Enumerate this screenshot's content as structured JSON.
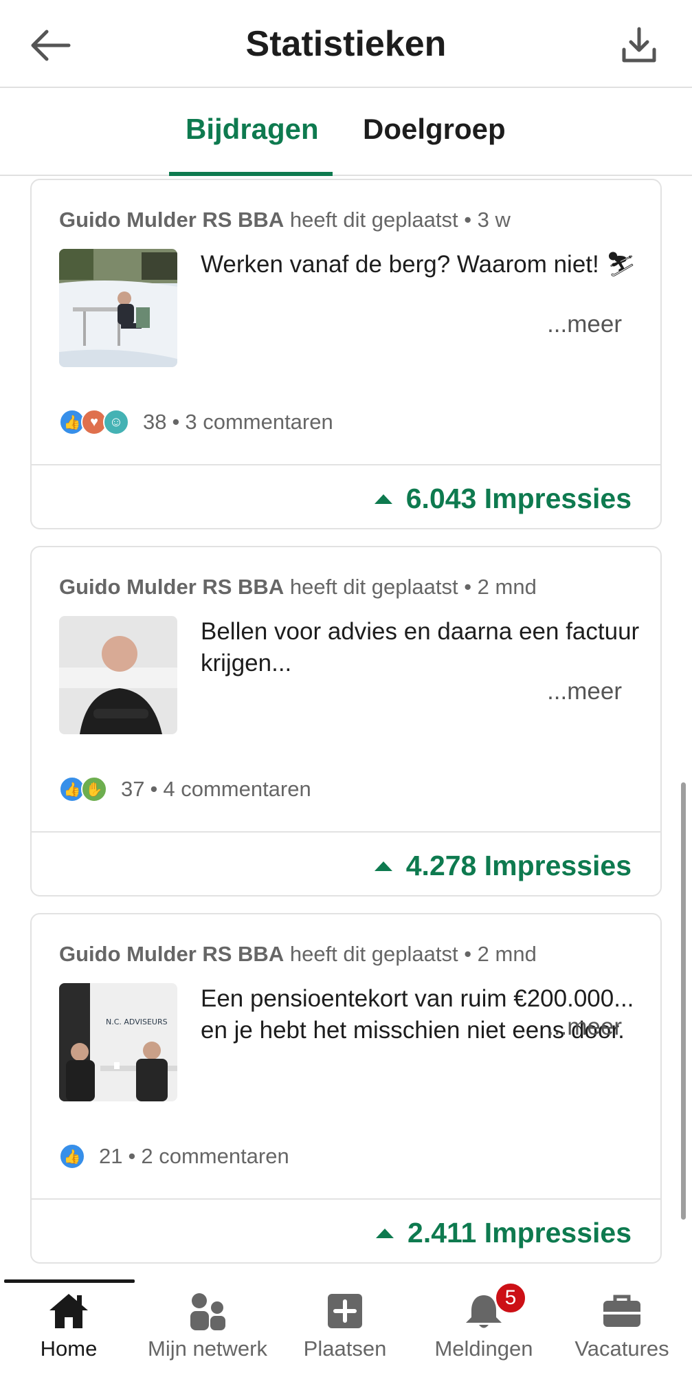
{
  "header": {
    "title": "Statistieken",
    "back_icon": "arrow-left-icon",
    "download_icon": "download-icon"
  },
  "tabs": [
    {
      "label": "Bijdragen",
      "active": true
    },
    {
      "label": "Doelgroep",
      "active": false
    }
  ],
  "posts": [
    {
      "author": "Guido Mulder RS BBA",
      "action": "heeft dit geplaatst",
      "time": "3 w",
      "text": "Werken vanaf de berg? Waarom niet! ⛷",
      "more": "...meer",
      "reaction_count": "38",
      "comments": "3 commentaren",
      "impressions": "6.043 Impressies"
    },
    {
      "author": "Guido Mulder RS BBA",
      "action": "heeft dit geplaatst",
      "time": "2 mnd",
      "text": "Bellen voor advies en daarna een factuur krijgen...",
      "more": "...meer",
      "reaction_count": "37",
      "comments": "4 commentaren",
      "impressions": "4.278 Impressies"
    },
    {
      "author": "Guido Mulder RS BBA",
      "action": "heeft dit geplaatst",
      "time": "2 mnd",
      "text": "Een pensioentekort van ruim €200.000... en je hebt het misschien niet eens door.",
      "more": "...meer",
      "reaction_count": "21",
      "comments": "2 commentaren",
      "impressions": "2.411 Impressies",
      "thumb_text": "N.C. ADVISEURS"
    }
  ],
  "nav": {
    "home": "Home",
    "network": "Mijn netwerk",
    "post": "Plaatsen",
    "notifications": "Meldingen",
    "notifications_badge": "5",
    "jobs": "Vacatures"
  },
  "colors": {
    "accent": "#0e7a4f",
    "badge": "#cc1016"
  }
}
